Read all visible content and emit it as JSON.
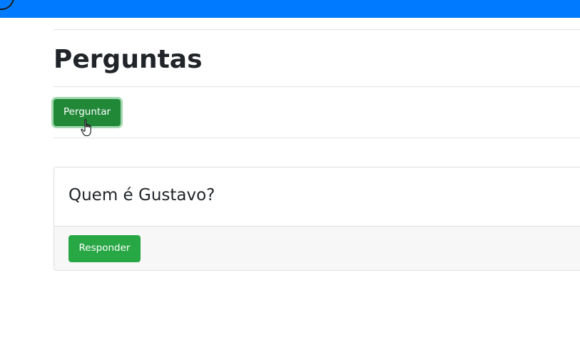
{
  "header": {
    "title": "Perguntas"
  },
  "toolbar": {
    "ask_label": "Perguntar"
  },
  "questions": [
    {
      "title": "Quem é Gustavo?",
      "answer_label": "Responder"
    }
  ],
  "colors": {
    "navbar": "#007bff",
    "ask_button": "#218838",
    "answer_button": "#28a745",
    "card_footer": "#f7f7f7",
    "text": "#212529"
  },
  "icons": {
    "navbar": "circle-icon",
    "cursor": "hand-pointer-icon"
  }
}
